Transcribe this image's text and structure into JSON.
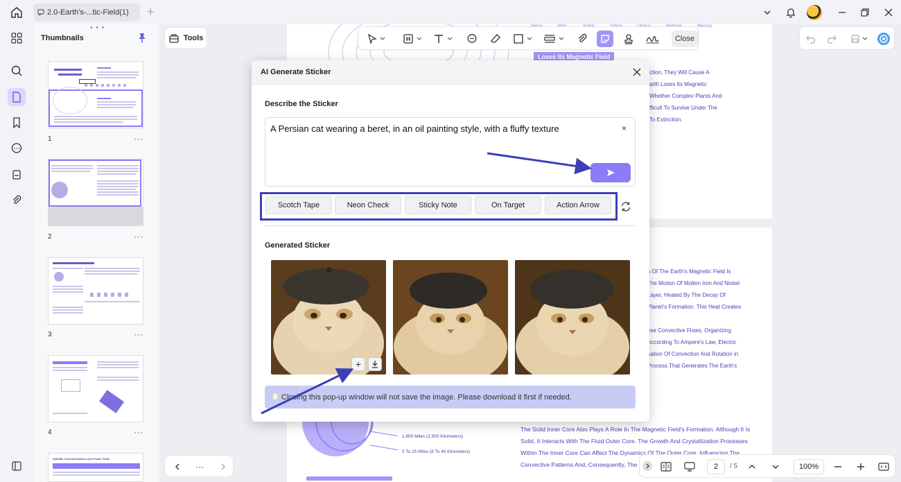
{
  "titlebar": {
    "tab_title": "2.0-Earth's-...tic-Field(1)"
  },
  "thumbnails": {
    "title": "Thumbnails",
    "pages": [
      {
        "number": "1"
      },
      {
        "number": "2"
      },
      {
        "number": "3"
      },
      {
        "number": "4"
      }
    ],
    "more_label": "···"
  },
  "toolbar": {
    "tools_label": "Tools",
    "close_label": "Close"
  },
  "document": {
    "top_header_labels": [
      "Venus",
      "Mars",
      "Jupiter",
      "Saturn",
      "Uranus",
      "Neptune",
      "Mercury"
    ],
    "highlight_label": "Loses Its Magnetic Field",
    "top_right_lines": [
      "ction, They Will Cause A",
      "arth Loses Its Magnetic",
      "Whether Complex Plants And",
      "fficult To Survive Under The",
      "To Extinction."
    ],
    "mid_right_lines": [
      "n Of The Earth's Magnetic Field Is",
      "The Motion Of Molten Iron And Nickel",
      "Layer, Heated By The Decay Of",
      "Planet's Formation. This Heat Creates",
      "ese Convective Flows, Organizing",
      "According To Ampere's Law, Electric",
      "nation Of Convection And Rotation in",
      "Process That Generates The Earth's"
    ],
    "diagram_labels": [
      "1,800 Miles (2,900 Kilometers)",
      "5 To 25 Miles (8 To 40 Kilometers)"
    ],
    "bottom_lines": [
      "The Solid Inner Core Also Plays A Role In The Magnetic Field's Formation. Although It Is",
      "Solid, It Interacts With The Fluid Outer Core. The Growth And Crystallization Processes",
      "Within The Inner Core Can Affect The Dynamics Of The Outer Core, Influencing The",
      "Convective Patterns And, Consequently, The Ma"
    ],
    "thumb4_title": "Satellite Communications And Power Grids"
  },
  "page_nav": {
    "more_label": "···"
  },
  "bottom_bar": {
    "current_page": "2",
    "total_pages": "/ 5",
    "zoom": "100%"
  },
  "dialog": {
    "title": "AI Generate Sticker",
    "describe_label": "Describe the Sticker",
    "prompt_value": "A Persian cat wearing a beret, in an oil painting style, with a fluffy texture",
    "clear_label": "×",
    "presets": [
      "Scotch Tape",
      "Neon Check",
      "Sticky Note",
      "On Target",
      "Action Arrow"
    ],
    "generated_label": "Generated Sticker",
    "add_label": "+",
    "notice": "Closing this pop-up window will not save the image. Please download it first if needed."
  },
  "colors": {
    "accent": "#8a7df5",
    "annotation_arrow": "#3c3fb8",
    "doc_text": "#4b44b8"
  }
}
